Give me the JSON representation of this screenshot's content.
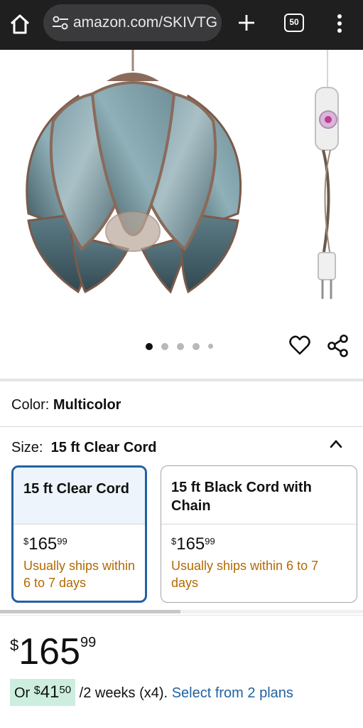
{
  "browser": {
    "url": "amazon.com/SKIVTG",
    "tab_count": "50"
  },
  "product": {
    "image_alt_icon": "lotus-pendant-lamp",
    "carousel_count": 5,
    "carousel_active": 1
  },
  "color": {
    "label": "Color:",
    "value": "Multicolor"
  },
  "size": {
    "label": "Size:",
    "value": "15 ft Clear Cord",
    "options": [
      {
        "title": "15 ft Clear Cord",
        "price_symbol": "$",
        "price_whole": "165",
        "price_fraction": "99",
        "shipping": "Usually ships within 6 to 7 days",
        "selected": true
      },
      {
        "title": "15 ft Black Cord with Chain",
        "price_symbol": "$",
        "price_whole": "165",
        "price_fraction": "99",
        "shipping": "Usually ships within 6 to 7 days",
        "selected": false
      }
    ]
  },
  "price": {
    "symbol": "$",
    "whole": "165",
    "fraction": "99"
  },
  "installment": {
    "prefix": "Or ",
    "symbol": "$",
    "amount": "41",
    "fraction": "50",
    "suffix": " /2 weeks (x4).",
    "link": "Select from 2 plans"
  },
  "colors": {
    "browser_bar": "#1f1f1f",
    "selected_border": "#2162a1",
    "shipping_text": "#b26a00",
    "link": "#2162a1",
    "installment_badge": "#cdeede"
  }
}
